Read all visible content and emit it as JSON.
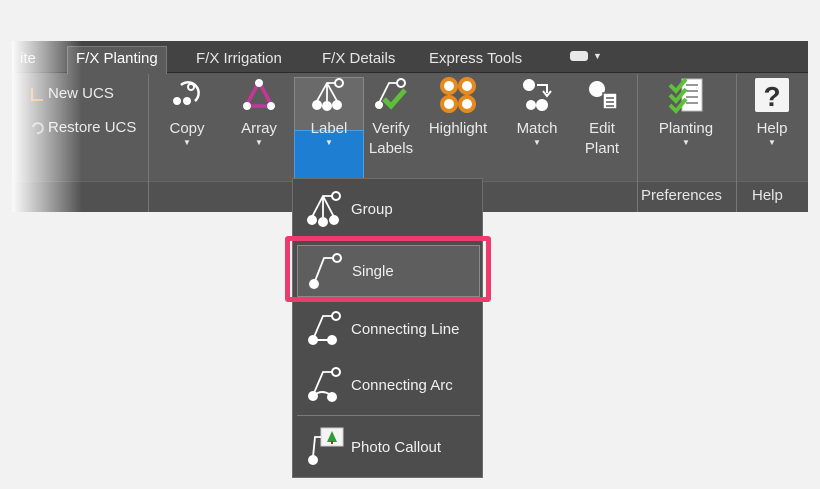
{
  "tabs": [
    {
      "label": "ite",
      "active": false
    },
    {
      "label": "F/X Planting",
      "active": true
    },
    {
      "label": "F/X Irrigation",
      "active": false
    },
    {
      "label": "F/X Details",
      "active": false
    },
    {
      "label": "Express Tools",
      "active": false
    }
  ],
  "ucs": {
    "new": "New UCS",
    "restore": "Restore UCS"
  },
  "tools": {
    "copy": "Copy",
    "array": "Array",
    "label": "Label",
    "verify": [
      "Verify",
      "Labels"
    ],
    "highlight": "Highlight",
    "match": "Match",
    "edit": [
      "Edit",
      "Plant"
    ],
    "planting": "Planting",
    "help": "Help"
  },
  "panels": {
    "preferences": "Preferences",
    "help": "Help"
  },
  "dropdown": {
    "items": [
      {
        "label": "Group",
        "icon": "label-group-icon"
      },
      {
        "label": "Single",
        "icon": "label-single-icon"
      },
      {
        "label": "Connecting Line",
        "icon": "label-connecting-line-icon"
      },
      {
        "label": "Connecting Arc",
        "icon": "label-connecting-arc-icon"
      },
      {
        "label": "Photo Callout",
        "icon": "photo-callout-icon"
      }
    ],
    "selected": "Single"
  },
  "colors": {
    "ribbon": "#595959",
    "active_blue": "#1e7fd2",
    "highlight_pink": "#ee3b6e",
    "icon_green": "#5fbf3a",
    "icon_orange": "#e58a1f",
    "icon_magenta": "#c8359a"
  }
}
